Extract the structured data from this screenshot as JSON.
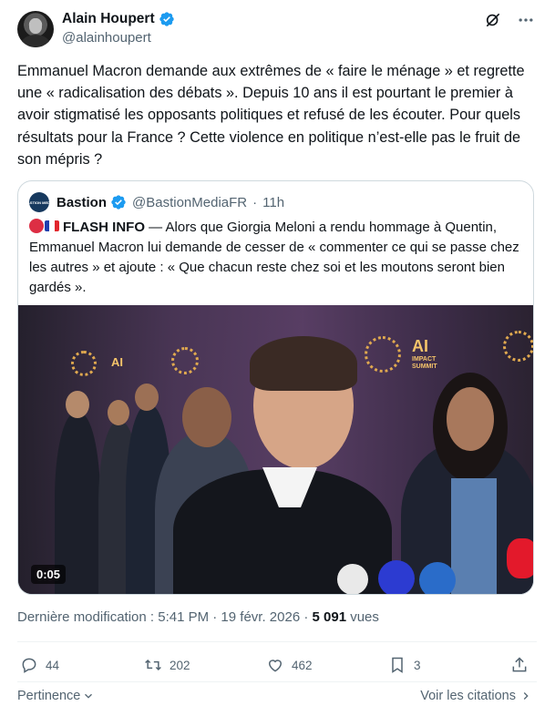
{
  "author": {
    "display_name": "Alain Houpert",
    "handle": "@alainhoupert",
    "avatar_icon": "avatar-photo",
    "verified_color": "#1d9bf0"
  },
  "post": {
    "text": "Emmanuel Macron demande aux extrêmes de « faire le ménage » et regrette une « radicalisation des débats ». Depuis 10 ans il est pourtant le premier à avoir stigmatisé les opposants politiques et refusé de les écouter. Pour quels résultats pour la France ? Cette violence en politique n’est-elle pas le fruit de son mépris ?"
  },
  "quoted": {
    "display_name": "Bastion",
    "handle": "@BastionMediaFR",
    "separator": "·",
    "time": "11h",
    "avatar_text": "BASTION MEDIA",
    "flash_label": "FLASH INFO",
    "text": "— Alors que Giorgia Meloni a rendu hommage à Quentin, Emmanuel Macron lui demande de cesser de « commenter ce qui se passe chez les autres » et ajoute : « Que chacun reste chez soi et les moutons seront bien gardés ».",
    "video": {
      "duration": "0:05",
      "banner_text": "AI",
      "banner_sub": "IMPACT SUMMIT"
    }
  },
  "meta": {
    "prefix": "Dernière modification : 5:41 PM · 19 févr. 2026 · ",
    "views_count": "5 091",
    "views_label": "vues"
  },
  "actions": {
    "replies": "44",
    "reposts": "202",
    "likes": "462",
    "bookmarks": "3"
  },
  "footer": {
    "relevance_label": "Pertinence",
    "quotes_link": "Voir les citations"
  },
  "colors": {
    "text": "#0f1419",
    "secondary": "#536471",
    "border": "#cfd9de",
    "accent": "#1d9bf0"
  }
}
